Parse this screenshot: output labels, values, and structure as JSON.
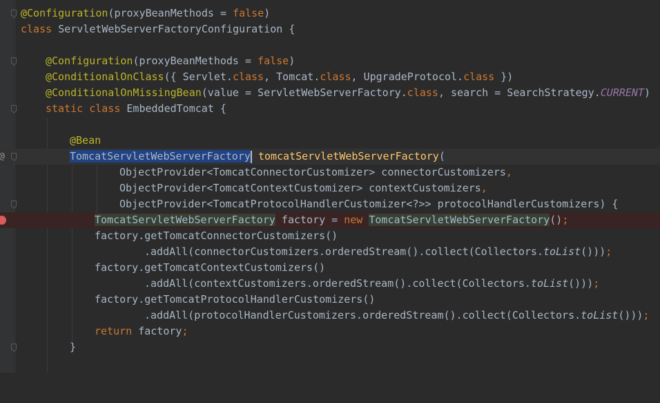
{
  "editor": {
    "lines": {
      "l1": {
        "a": "@Configuration",
        "b": "(proxyBeanMethods = ",
        "c": "false",
        "d": ")"
      },
      "l2": {
        "a": "class ",
        "b": "ServletWebServerFactoryConfiguration {"
      },
      "l4": {
        "a": "@Configuration",
        "b": "(proxyBeanMethods = ",
        "c": "false",
        "d": ")"
      },
      "l5": {
        "a": "@ConditionalOnClass",
        "b": "({ Servlet.",
        "c": "class",
        "d": ", Tomcat.",
        "e": "class",
        "f": ", UpgradeProtocol.",
        "g": "class",
        "h": " })"
      },
      "l6": {
        "a": "@ConditionalOnMissingBean",
        "b": "(value = ServletWebServerFactory.",
        "c": "class",
        "d": ", search = SearchStrategy.",
        "e": "CURRENT",
        "f": ")"
      },
      "l7": {
        "a": "static class ",
        "b": "EmbeddedTomcat {"
      },
      "l9": {
        "a": "@Bean"
      },
      "l10": {
        "a": "TomcatServletWebServerFactory",
        "b": " ",
        "c": "tomcatServletWebServerFactory",
        "d": "("
      },
      "l11": {
        "a": "ObjectProvider<TomcatConnectorCustomizer> connectorCustomizers",
        "b": ","
      },
      "l12": {
        "a": "ObjectProvider<TomcatContextCustomizer> contextCustomizers",
        "b": ","
      },
      "l13": {
        "a": "ObjectProvider<TomcatProtocolHandlerCustomizer<?>> protocolHandlerCustomizers) {"
      },
      "l14": {
        "a": "TomcatServletWebServerFactory",
        "b": " factory = ",
        "c": "new ",
        "d": "TomcatServletWebServerFactory",
        "e": "()",
        "f": ";"
      },
      "l15": {
        "a": "factory.getTomcatConnectorCustomizers()"
      },
      "l16": {
        "a": ".addAll(connectorCustomizers.orderedStream().collect(Collectors.",
        "b": "toList",
        "c": "()))",
        "d": ";"
      },
      "l17": {
        "a": "factory.getTomcatContextCustomizers()"
      },
      "l18": {
        "a": ".addAll(contextCustomizers.orderedStream().collect(Collectors.",
        "b": "toList",
        "c": "()))",
        "d": ";"
      },
      "l19": {
        "a": "factory.getTomcatProtocolHandlerCustomizers()"
      },
      "l20": {
        "a": ".addAll(protocolHandlerCustomizers.orderedStream().collect(Collectors.",
        "b": "toList",
        "c": "()))",
        "d": ";"
      },
      "l21": {
        "a": "return ",
        "b": "factory",
        "c": ";"
      },
      "l22": {
        "a": "}"
      }
    },
    "gutter": {
      "override_icon": "@",
      "breakpoint_icon": "breakpoint-icon"
    },
    "colors": {
      "background": "#2b2b2b",
      "keyword": "#cc7832",
      "annotation": "#bbb529",
      "constant": "#9876aa",
      "method": "#ffc66d",
      "text": "#a9b7c6",
      "selection": "#214283",
      "breakpoint": "#db5c5c"
    }
  }
}
